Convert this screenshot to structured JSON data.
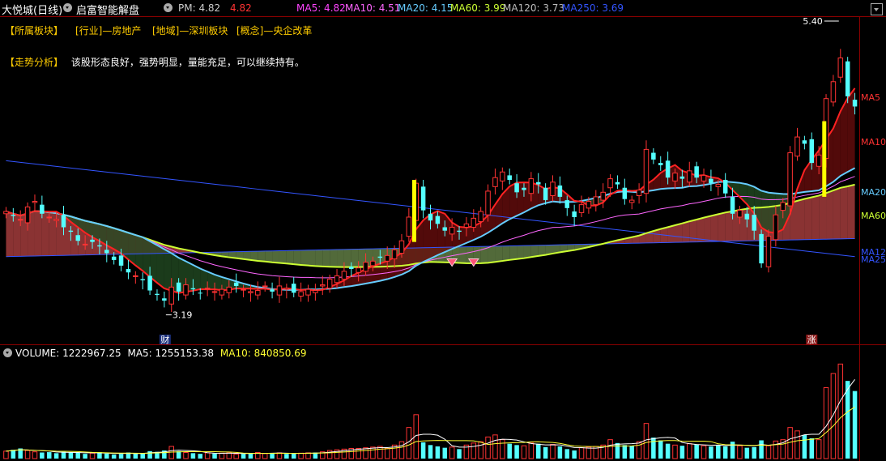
{
  "header": {
    "stock_title": "大悦城(日线)",
    "formula_name": "启富智能解盘",
    "pm_label": "PM: 4.82",
    "pm_value": "4.82",
    "ma_items": [
      {
        "label": "MA5: 4.82",
        "color": "#ff44ff"
      },
      {
        "label": "MA10: 4.51",
        "color": "#ff66ff"
      },
      {
        "label": "MA20: 4.15",
        "color": "#66ccff"
      },
      {
        "label": "MA60: 3.99",
        "color": "#ccff33"
      },
      {
        "label": "MA120: 3.73",
        "color": "#bbbbbb"
      },
      {
        "label": "MA250: 3.69",
        "color": "#3355ff"
      }
    ]
  },
  "sector_tags": {
    "label": "【所属板块】",
    "industry": "[行业]—房地产",
    "region": "[地域]—深圳板块",
    "concept": "[概念]—央企改革"
  },
  "analysis": {
    "label": "【走势分析】",
    "text": "该股形态良好，强势明显，量能充足，可以继续持有。"
  },
  "price_panel": {
    "high_annotation": "5.40",
    "low_annotation": "3.19",
    "finance_marker": "财",
    "limit_marker": "涨",
    "ma_line_labels": [
      {
        "text": "MA5",
        "color": "#ff3333"
      },
      {
        "text": "MA10",
        "color": "#ff3333"
      },
      {
        "text": "MA20",
        "color": "#66ccff"
      },
      {
        "text": "MA60",
        "color": "#ccff33"
      },
      {
        "text": "MA12",
        "color": "#3355ff"
      },
      {
        "text": "MA25",
        "color": "#3355ff"
      }
    ]
  },
  "volume_panel": {
    "volume": "VOLUME: 1222967.25",
    "ma5": "MA5: 1255153.38",
    "ma10": "MA10: 840850.69",
    "ma5_color": "#ffffff",
    "ma10_color": "#ffff33"
  },
  "colors": {
    "up": "#ff3333",
    "down": "#54ffff",
    "signal": "#ffff00",
    "grid": "#8b0000"
  },
  "chart_data": {
    "type": "candlestick",
    "price_axis_range": [
      2.85,
      5.75
    ],
    "closes": [
      4.02,
      3.98,
      3.95,
      4.06,
      4.11,
      4.0,
      3.97,
      3.95,
      3.88,
      3.84,
      3.76,
      3.73,
      3.75,
      3.71,
      3.65,
      3.59,
      3.54,
      3.48,
      3.45,
      3.41,
      3.32,
      3.28,
      3.23,
      3.35,
      3.31,
      3.37,
      3.33,
      3.3,
      3.34,
      3.31,
      3.33,
      3.35,
      3.36,
      3.33,
      3.31,
      3.32,
      3.36,
      3.31,
      3.36,
      3.34,
      3.3,
      3.31,
      3.33,
      3.32,
      3.37,
      3.42,
      3.45,
      3.49,
      3.51,
      3.52,
      3.57,
      3.58,
      3.61,
      3.63,
      3.68,
      3.76,
      3.97,
      4.27,
      4.03,
      3.94,
      3.91,
      3.85,
      3.88,
      3.84,
      3.91,
      3.96,
      4.02,
      4.2,
      4.32,
      4.37,
      4.3,
      4.19,
      4.21,
      4.31,
      4.26,
      4.12,
      4.28,
      4.15,
      4.05,
      3.97,
      4.08,
      4.11,
      4.15,
      4.19,
      4.31,
      4.26,
      4.13,
      4.12,
      4.21,
      4.57,
      4.48,
      4.43,
      4.32,
      4.36,
      4.31,
      4.38,
      4.32,
      4.34,
      4.27,
      4.26,
      4.18,
      4.0,
      4.03,
      3.95,
      3.85,
      3.56,
      3.8,
      3.99,
      4.1,
      4.54,
      4.68,
      4.62,
      4.45,
      4.52,
      5.02,
      5.17,
      5.38,
      5.04,
      4.95
    ],
    "volume_axis_max": 1500000,
    "volumes": [
      110000,
      130000,
      150000,
      120000,
      100000,
      90000,
      95000,
      80000,
      100000,
      90000,
      85000,
      70000,
      80000,
      95000,
      75000,
      60000,
      70000,
      90000,
      80000,
      75000,
      110000,
      100000,
      120000,
      180000,
      110000,
      90000,
      80000,
      70000,
      85000,
      75000,
      80000,
      85000,
      65000,
      70000,
      80000,
      90000,
      75000,
      80000,
      85000,
      70000,
      75000,
      80000,
      85000,
      90000,
      100000,
      120000,
      130000,
      140000,
      150000,
      150000,
      160000,
      170000,
      180000,
      150000,
      200000,
      250000,
      460000,
      650000,
      240000,
      200000,
      180000,
      160000,
      170000,
      140000,
      200000,
      230000,
      250000,
      320000,
      350000,
      280000,
      220000,
      200000,
      190000,
      230000,
      220000,
      170000,
      210000,
      180000,
      140000,
      120000,
      160000,
      170000,
      180000,
      200000,
      280000,
      230000,
      200000,
      190000,
      250000,
      520000,
      310000,
      270000,
      220000,
      200000,
      190000,
      220000,
      210000,
      190000,
      180000,
      200000,
      180000,
      250000,
      190000,
      160000,
      170000,
      270000,
      190000,
      260000,
      280000,
      460000,
      410000,
      350000,
      300000,
      280000,
      1050000,
      1260000,
      1400000,
      1150000,
      1000000
    ]
  }
}
